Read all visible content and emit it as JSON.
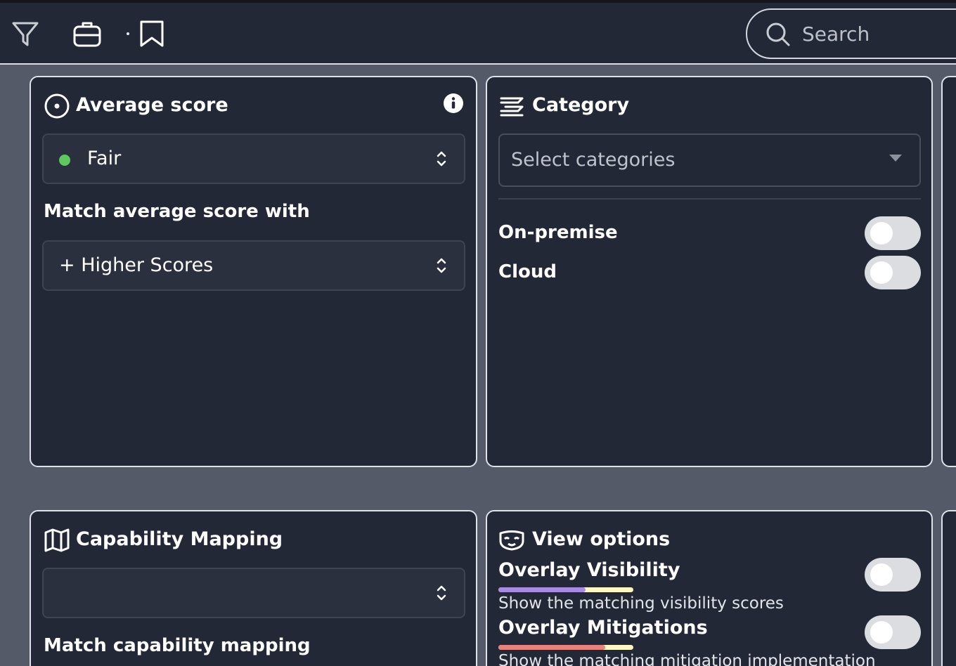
{
  "toolbar": {
    "icons": [
      "filter-icon",
      "briefcase-icon",
      "bookmark-icon"
    ],
    "search_placeholder": "Search"
  },
  "average_score": {
    "title": "Average score",
    "selected_value": "Fair",
    "status_color": "#5fc760",
    "match_label": "Match average score with",
    "match_value": "+ Higher Scores"
  },
  "category": {
    "title": "Category",
    "select_placeholder": "Select categories",
    "toggles": [
      {
        "label": "On-premise",
        "on": false
      },
      {
        "label": "Cloud",
        "on": false
      }
    ]
  },
  "capability_mapping": {
    "title": "Capability Mapping",
    "selected_value": "",
    "match_label": "Match capability mapping"
  },
  "view_options": {
    "title": "View options",
    "items": [
      {
        "label": "Overlay Visibility",
        "description": "Show the matching visibility scores",
        "on": false,
        "bar_colors": [
          "#a98ae3",
          "#fff7c4"
        ]
      },
      {
        "label": "Overlay Mitigations",
        "description": "Show the matching mitigation implementation",
        "on": false,
        "bar_colors": [
          "#e9827a",
          "#fff7c4"
        ]
      }
    ]
  },
  "colors": {
    "page_background": "#545a67",
    "card_background": "#222835",
    "card_border": "#dfe2e8",
    "toggle_off": "#dcdde0"
  }
}
